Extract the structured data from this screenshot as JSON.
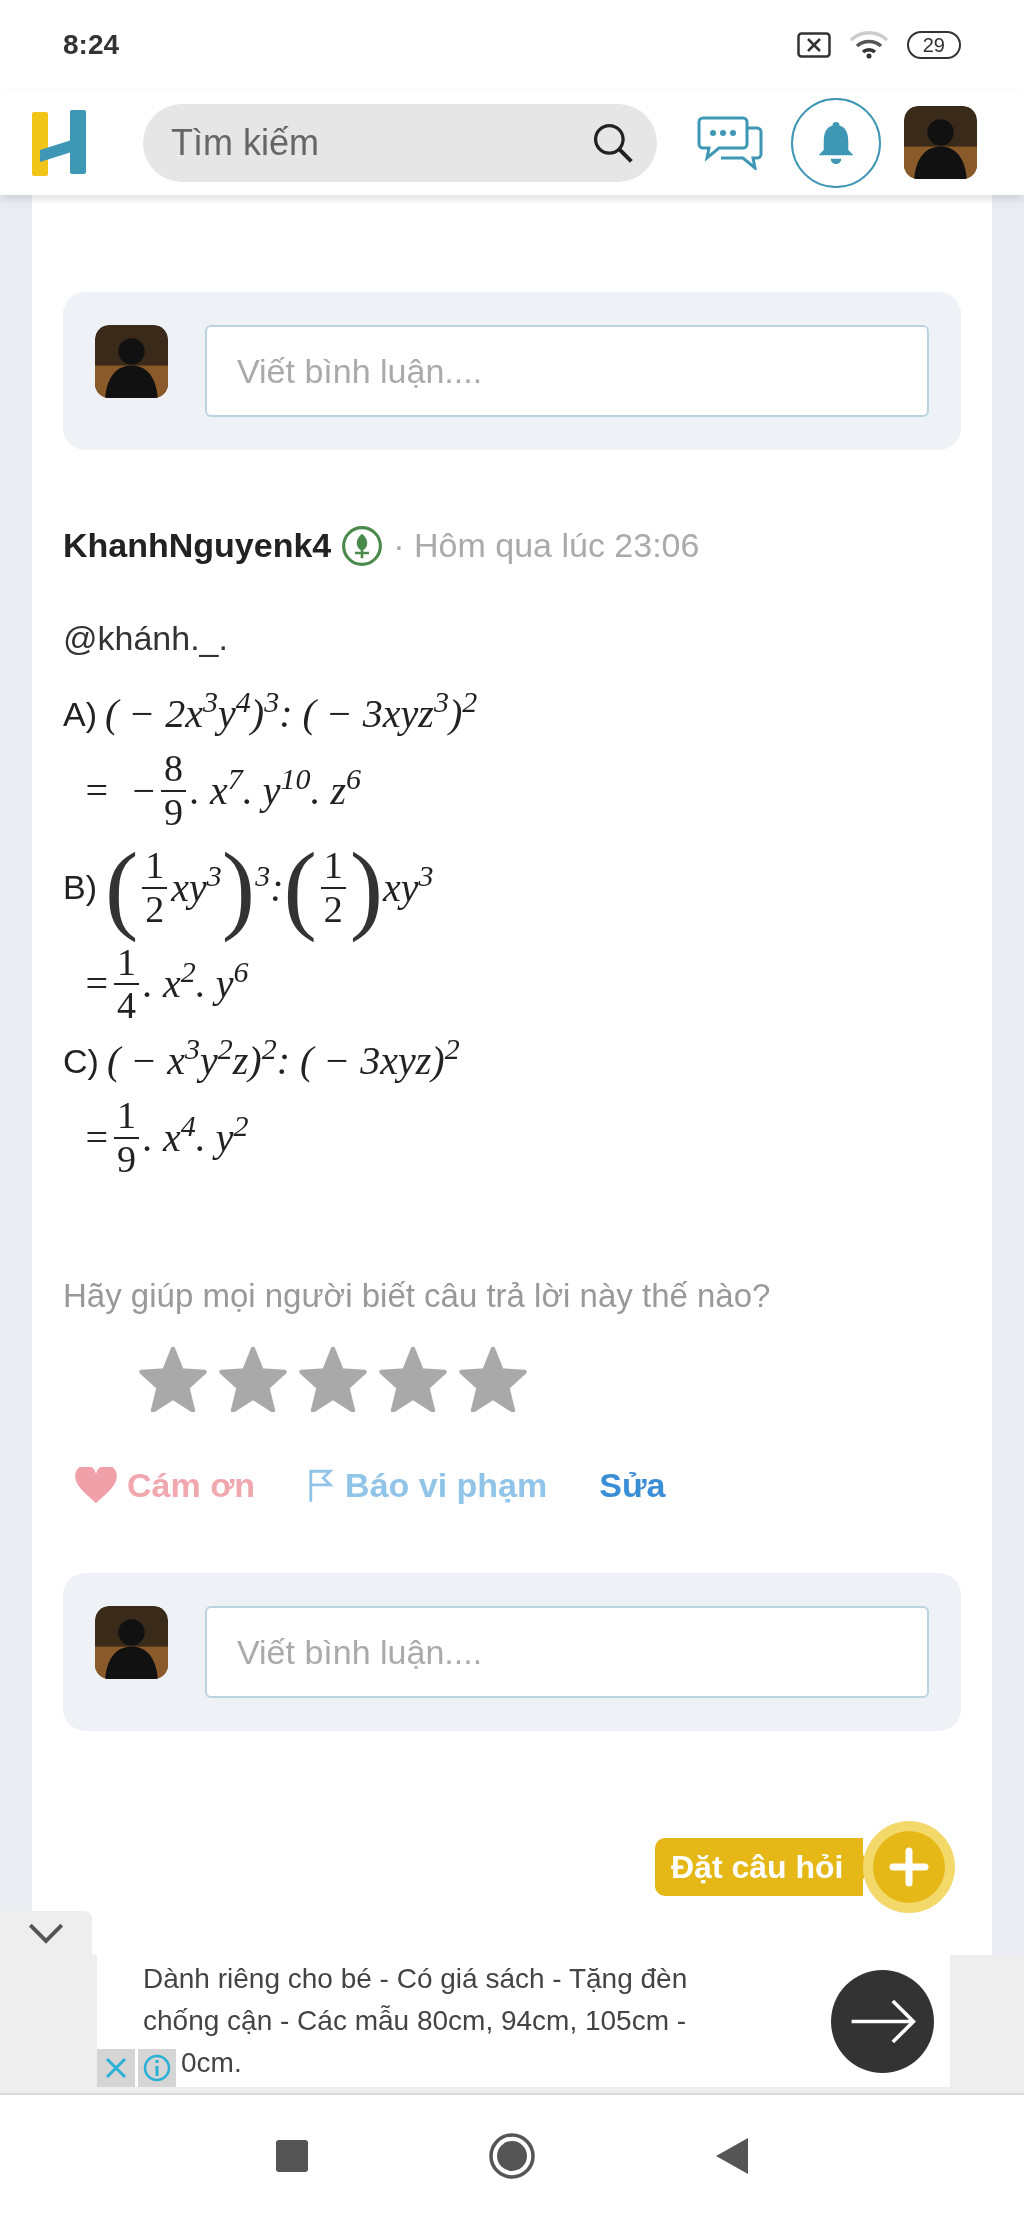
{
  "status_bar": {
    "time": "8:24",
    "battery": "29"
  },
  "header": {
    "search": {
      "placeholder": "Tìm kiếm"
    }
  },
  "comment_box_top": {
    "placeholder": "Viết bình luận...."
  },
  "answer": {
    "author": "KhanhNguyenk4",
    "time": "· Hôm qua lúc 23:06",
    "mention": "@khánh._.",
    "lines": [
      {
        "label": "A)",
        "parts": [
          {
            "kind": "text",
            "text": "( − 2x$^{3}$y$^{4}$)$^{3}$: ( − 3xyz$^{3}$)$^{2}$"
          }
        ]
      },
      {
        "parts": [
          {
            "kind": "text",
            "text": "=  −"
          },
          {
            "kind": "frac",
            "num": "8",
            "den": "9"
          },
          {
            "kind": "text",
            "text": ". x$^{7}$. y$^{10}$. z$^{6}$"
          }
        ]
      },
      {
        "label": "B)",
        "parts": [
          {
            "kind": "big",
            "text": "("
          },
          {
            "kind": "frac",
            "num": "1",
            "den": "2"
          },
          {
            "kind": "text",
            "text": "xy$^{3}$"
          },
          {
            "kind": "big",
            "text": ")"
          },
          {
            "kind": "text",
            "text": "$^{3}$:"
          },
          {
            "kind": "big",
            "text": "("
          },
          {
            "kind": "frac",
            "num": "1",
            "den": "2"
          },
          {
            "kind": "big",
            "text": ")"
          },
          {
            "kind": "text",
            "text": "xy$^{3}$"
          }
        ]
      },
      {
        "parts": [
          {
            "kind": "text",
            "text": "="
          },
          {
            "kind": "frac",
            "num": "1",
            "den": "4"
          },
          {
            "kind": "text",
            "text": ". x$^{2}$. y$^{6}$"
          }
        ]
      },
      {
        "label": "C)",
        "parts": [
          {
            "kind": "text",
            "text": "( − x$^{3}$y$^{2}$z)$^{2}$: ( − 3xyz)$^{2}$"
          }
        ]
      },
      {
        "parts": [
          {
            "kind": "text",
            "text": "="
          },
          {
            "kind": "frac",
            "num": "1",
            "den": "9"
          },
          {
            "kind": "text",
            "text": ". x$^{4}$. y$^{2}$"
          }
        ]
      }
    ]
  },
  "rating": {
    "prompt": "Hãy giúp mọi người biết câu trả lời này thế nào?",
    "stars": 0
  },
  "actions": [
    {
      "kind": "thanks",
      "label": "Cám ơn"
    },
    {
      "kind": "report",
      "label": "Báo vi phạm"
    },
    {
      "kind": "edit",
      "label": "Sửa"
    }
  ],
  "comment_box_bottom": {
    "placeholder": "Viết bình luận...."
  },
  "ask_button": {
    "label": "Đặt câu hỏi"
  },
  "ad": {
    "lines": [
      "Dành riêng cho bé - Có giá sách - Tặng đèn",
      "chống cận - Các mẫu 80cm, 94cm, 105cm -",
      "0cm."
    ]
  }
}
